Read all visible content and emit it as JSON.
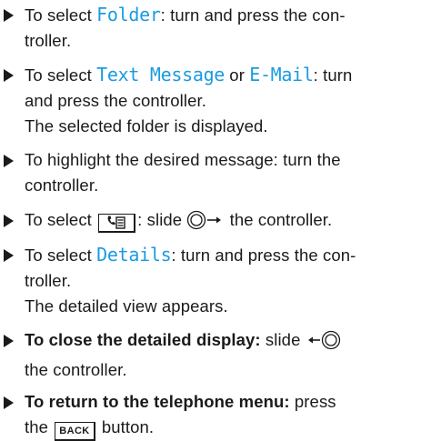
{
  "steps": [
    {
      "arrow_icon": "triangle-right-bullet",
      "line1": {
        "pre": "To select ",
        "menu": "Folder",
        "post": ": turn and press the con-"
      },
      "line2": "troller."
    },
    {
      "arrow_icon": "triangle-right-bullet",
      "line1": {
        "pre": "To select ",
        "menu1": "Text Message",
        "mid": " or ",
        "menu2": "E-Mail",
        "post": ": turn"
      },
      "line2": "and press the controller.",
      "result": "The selected folder is displayed."
    },
    {
      "arrow_icon": "triangle-right-bullet",
      "line1": "To highlight the desired message: turn the",
      "line2": "controller."
    },
    {
      "arrow_icon": "triangle-right-bullet",
      "line1": {
        "pre": "To select ",
        "key_icon": "phone-menu-key-icon",
        "mid": ": slide ",
        "ctrl_icon": "controller-slide-right-icon",
        "post": " the controller."
      }
    },
    {
      "arrow_icon": "triangle-right-bullet",
      "line1": {
        "pre": "To select ",
        "menu": "Details",
        "post": ": turn and press the con-"
      },
      "line2": "troller.",
      "result": "The detailed view appears."
    },
    {
      "arrow_icon": "triangle-right-bullet",
      "line1": {
        "bold": "To close the detailed display:",
        "mid": " slide ",
        "ctrl_icon": "controller-slide-left-icon"
      },
      "line2": "the controller."
    },
    {
      "arrow_icon": "triangle-right-bullet",
      "line1": {
        "bold": "To return to the telephone menu:",
        "post": " press"
      },
      "line2": {
        "pre": "the ",
        "key": "BACK",
        "post": " button."
      }
    }
  ]
}
